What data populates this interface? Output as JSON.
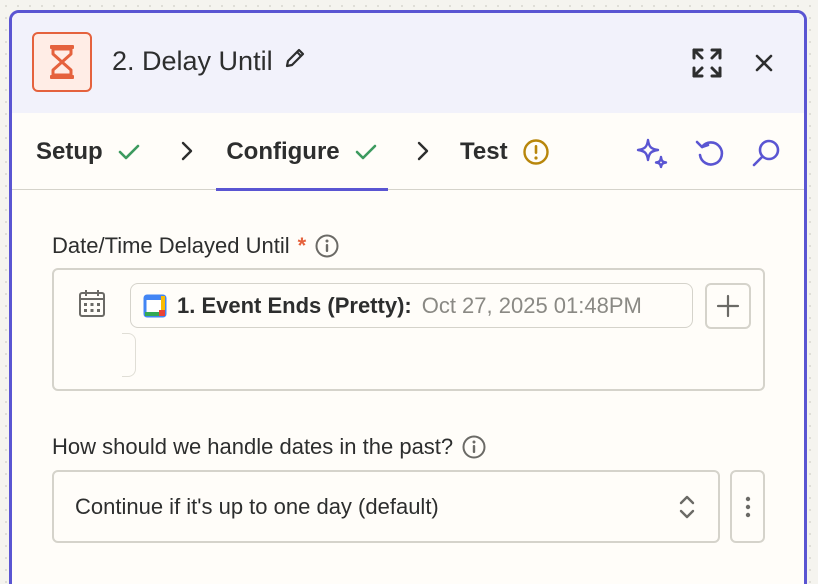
{
  "step": {
    "title": "2. Delay Until",
    "app_icon": "hourglass-icon",
    "accent_color": "#5a55d2",
    "app_color": "#e5623d"
  },
  "tabs": [
    {
      "label": "Setup",
      "status": "complete"
    },
    {
      "label": "Configure",
      "status": "complete",
      "active": true
    },
    {
      "label": "Test",
      "status": "warning"
    }
  ],
  "toolbar_icons": [
    "sparkle-icon",
    "undo-icon",
    "search-icon"
  ],
  "fields": {
    "date": {
      "label": "Date/Time Delayed Until",
      "required_marker": "*",
      "token_key": "1. Event Ends (Pretty):",
      "token_value": "Oct 27, 2025 01:48PM"
    },
    "past": {
      "label": "How should we handle dates in the past?",
      "selected": "Continue if it's up to one day (default)"
    }
  }
}
